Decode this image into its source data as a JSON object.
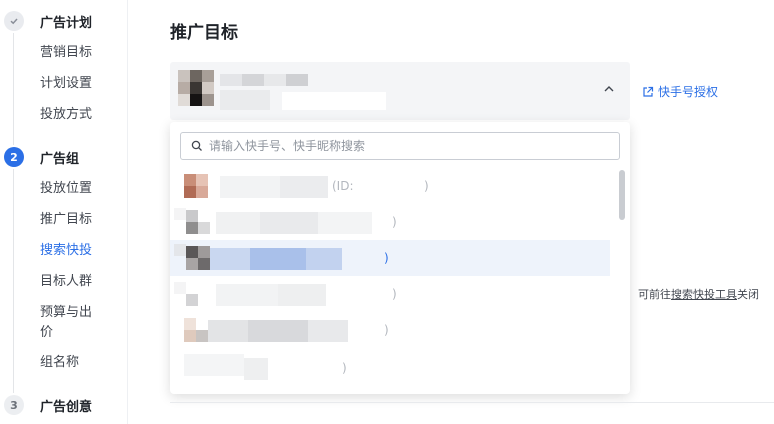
{
  "nav": {
    "steps": [
      {
        "index": "✓",
        "title": "广告计划",
        "state": "done"
      },
      {
        "index": "2",
        "title": "广告组",
        "state": "active"
      },
      {
        "index": "3",
        "title": "广告创意",
        "state": "todo"
      }
    ],
    "plan_items": [
      "营销目标",
      "计划设置",
      "投放方式"
    ],
    "group_items": [
      "投放位置",
      "推广目标",
      "搜索快投",
      "目标人群",
      "预算与出价",
      "组名称"
    ],
    "active_item": "搜索快投"
  },
  "main": {
    "title": "推广目标",
    "auth_link": "快手号授权",
    "search_placeholder": "请输入快手号、快手昵称搜索",
    "options": [
      {
        "text": "(ID:",
        "suffix": ")"
      },
      {
        "text": "",
        "suffix": ")"
      },
      {
        "text": "",
        "suffix": ")",
        "highlighted": true
      },
      {
        "text": "",
        "suffix": ")"
      },
      {
        "text": "",
        "suffix": ")"
      },
      {
        "text": "",
        "suffix": ")"
      }
    ],
    "tip_prefix": "可前往",
    "tip_link": "搜索快投工具",
    "tip_suffix": "关闭"
  },
  "colors": {
    "accent": "#2b6fe6",
    "highlight_row": "#eef3fb"
  }
}
